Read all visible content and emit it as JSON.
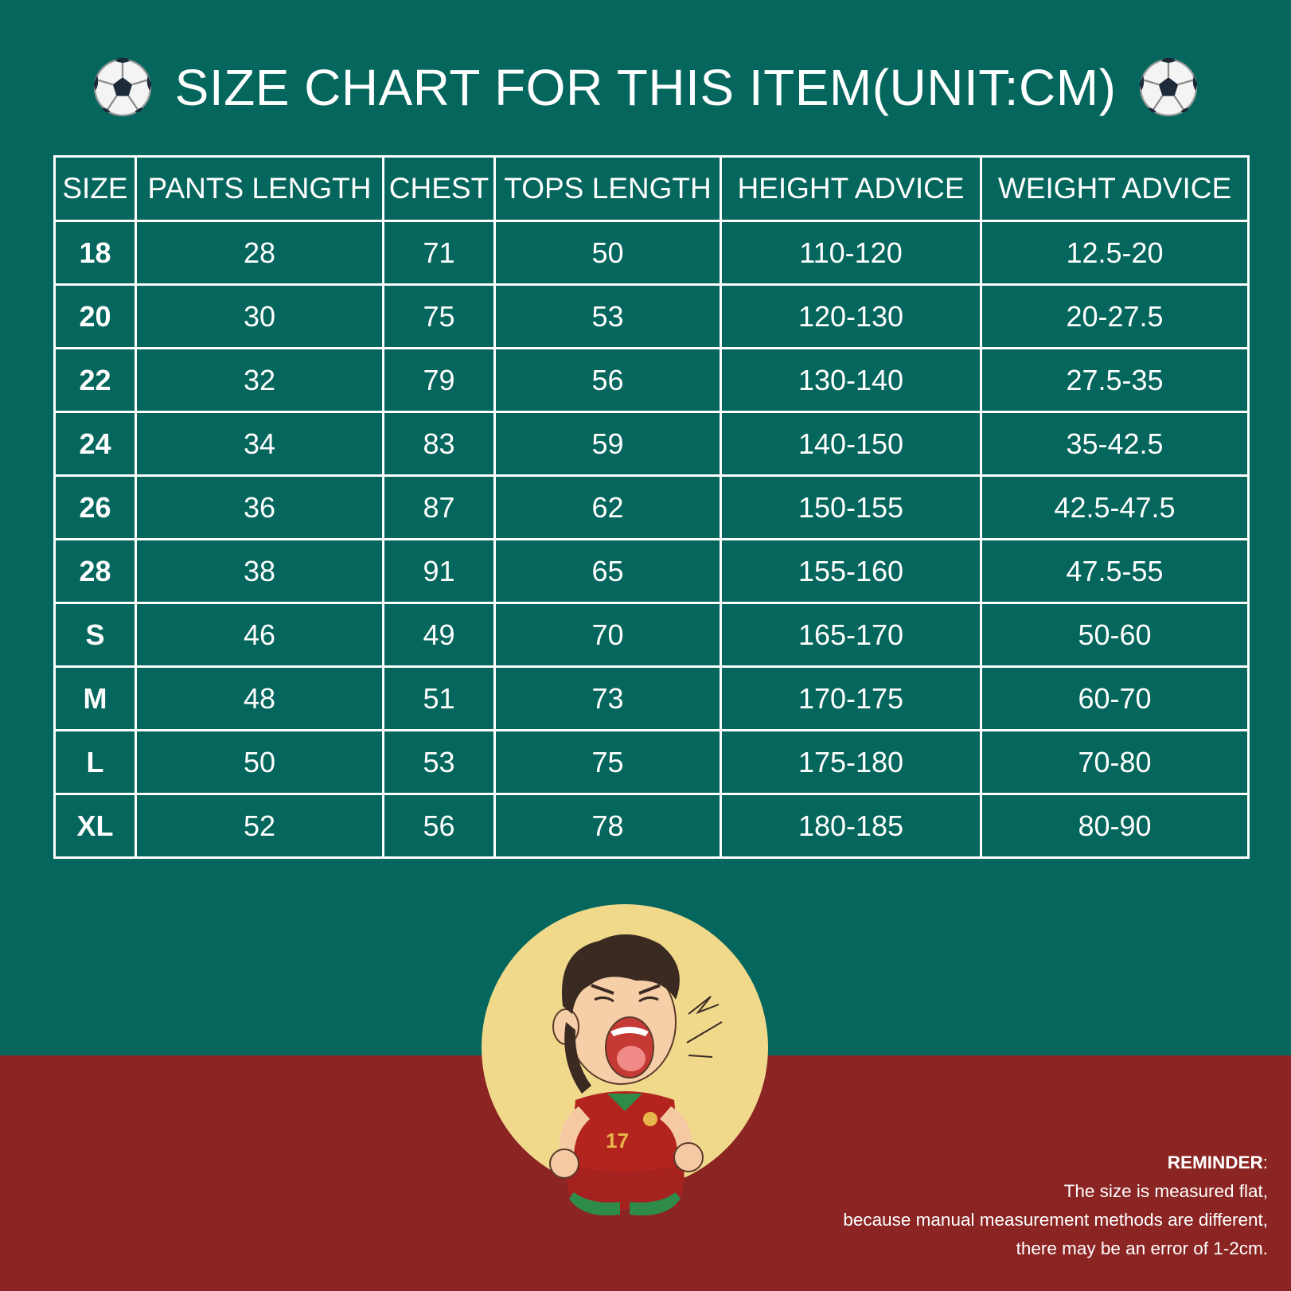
{
  "title": "SIZE CHART FOR THIS ITEM(UNIT:CM)",
  "colors": {
    "background_green": "#04665c",
    "bottom_red": "#8b2523",
    "grid_lines": "#ffffff",
    "mascot_circle": "#f1d98c"
  },
  "icons": [
    "soccer-ball-icon",
    "soccer-ball-icon"
  ],
  "table": {
    "headers": [
      "SIZE",
      "PANTS LENGTH",
      "CHEST",
      "TOPS LENGTH",
      "HEIGHT ADVICE",
      "WEIGHT ADVICE"
    ],
    "rows": [
      [
        "18",
        "28",
        "71",
        "50",
        "110-120",
        "12.5-20"
      ],
      [
        "20",
        "30",
        "75",
        "53",
        "120-130",
        "20-27.5"
      ],
      [
        "22",
        "32",
        "79",
        "56",
        "130-140",
        "27.5-35"
      ],
      [
        "24",
        "34",
        "83",
        "59",
        "140-150",
        "35-42.5"
      ],
      [
        "26",
        "36",
        "87",
        "62",
        "150-155",
        "42.5-47.5"
      ],
      [
        "28",
        "38",
        "91",
        "65",
        "155-160",
        "47.5-55"
      ],
      [
        "S",
        "46",
        "49",
        "70",
        "165-170",
        "50-60"
      ],
      [
        "M",
        "48",
        "51",
        "73",
        "170-175",
        "60-70"
      ],
      [
        "L",
        "50",
        "53",
        "75",
        "175-180",
        "70-80"
      ],
      [
        "XL",
        "52",
        "56",
        "78",
        "180-185",
        "80-90"
      ]
    ]
  },
  "mascot": {
    "jersey_number": "17"
  },
  "reminder": {
    "title": "REMINDER",
    "colon": ":",
    "lines": [
      "The size is measured flat,",
      "because manual measurement methods are different,",
      "there may be an error of 1-2cm."
    ]
  }
}
